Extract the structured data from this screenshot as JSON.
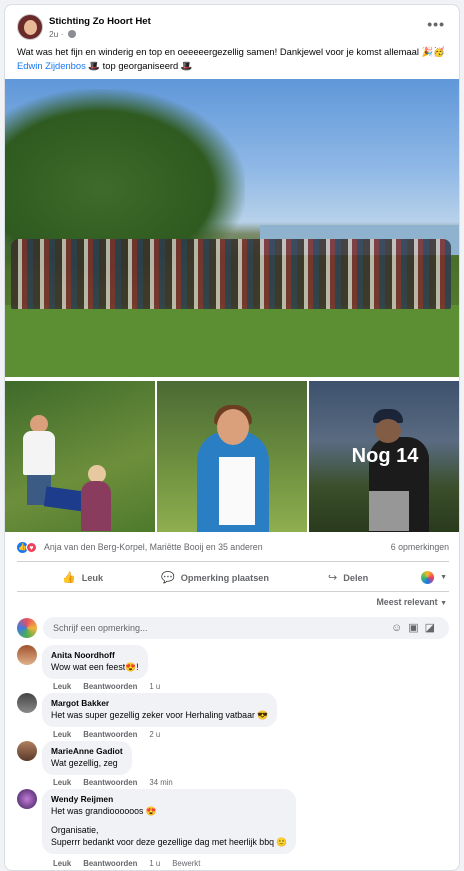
{
  "post": {
    "page_name": "Stichting Zo Hoort Het",
    "time": "2u",
    "more_label": "•••",
    "text_before": "Wat was het fijn en winderig en top en oeeeeergezellig samen! Dankjewel voor je komst allemaal 🎉🥳 ",
    "mention": "Edwin Zijdenbos",
    "text_after": "🎩 top georganiseerd 🎩",
    "more_photos": "Nog 14"
  },
  "reactions": {
    "names": "Anja van den Berg-Korpel, Mariëtte Booij en 35 anderen",
    "comment_count": "6 opmerkingen"
  },
  "actions": {
    "like": "Leuk",
    "comment": "Opmerking plaatsen",
    "share": "Delen"
  },
  "sort_label": "Meest relevant",
  "comment_box": {
    "placeholder": "Schrijf een opmerking..."
  },
  "comments": [
    {
      "name": "Anita Noordhoff",
      "lines": [
        "Wow wat een feest😍!"
      ],
      "like": "Leuk",
      "reply": "Beantwoorden",
      "time": "1 u"
    },
    {
      "name": "Margot Bakker",
      "lines": [
        "Het was super gezellig zeker voor Herhaling vatbaar 😎"
      ],
      "like": "Leuk",
      "reply": "Beantwoorden",
      "time": "2 u"
    },
    {
      "name": "MarieAnne Gadiot",
      "lines": [
        "Wat gezellig, zeg"
      ],
      "like": "Leuk",
      "reply": "Beantwoorden",
      "time": "34 min"
    },
    {
      "name": "Wendy Reijmen",
      "lines": [
        "Het was grandioooooos 😍",
        "",
        "Organisatie,",
        "Superrr bedankt voor deze gezellige dag met heerlijk bbq 🙂"
      ],
      "like": "Leuk",
      "reply": "Beantwoorden",
      "time": "1 u",
      "edited": "Bewerkt"
    }
  ]
}
